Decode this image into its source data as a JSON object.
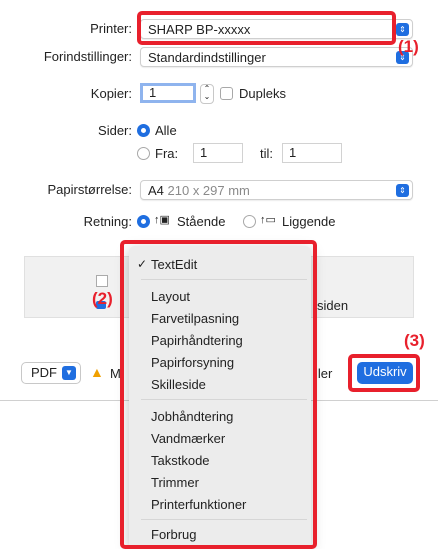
{
  "printer": {
    "label": "Printer:",
    "value": "SHARP BP-xxxxx"
  },
  "presets": {
    "label": "Forindstillinger:",
    "value": "Standardindstillinger"
  },
  "copies": {
    "label": "Kopier:",
    "value": "1",
    "duplex_label": "Dupleks"
  },
  "pages": {
    "label": "Sider:",
    "all_label": "Alle",
    "from_label": "Fra:",
    "from_value": "1",
    "to_label": "til:",
    "to_value": "1"
  },
  "paper_size": {
    "label": "Papirstørrelse:",
    "value": "A4",
    "dims": "210 x 297 mm"
  },
  "orientation": {
    "label": "Retning:",
    "portrait_label": "Stående",
    "landscape_label": "Liggende"
  },
  "behind_menu_text": "siden",
  "menu": {
    "checked_item": "TextEdit",
    "group1": [
      "Layout",
      "Farvetilpasning",
      "Papirhåndtering",
      "Papirforsyning",
      "Skilleside"
    ],
    "group2": [
      "Jobhåndtering",
      "Vandmærker",
      "Takstkode",
      "Trimmer",
      "Printerfunktioner"
    ],
    "group3": [
      "Forbrug"
    ]
  },
  "bottom": {
    "pdf_label": "PDF",
    "warning_text": "M",
    "cancel_partial": "ller",
    "print_label": "Udskriv"
  },
  "callouts": {
    "c1": "(1)",
    "c2": "(2)",
    "c3": "(3)"
  },
  "colors": {
    "accent": "#1f6ee0",
    "highlight": "#e8202c"
  }
}
